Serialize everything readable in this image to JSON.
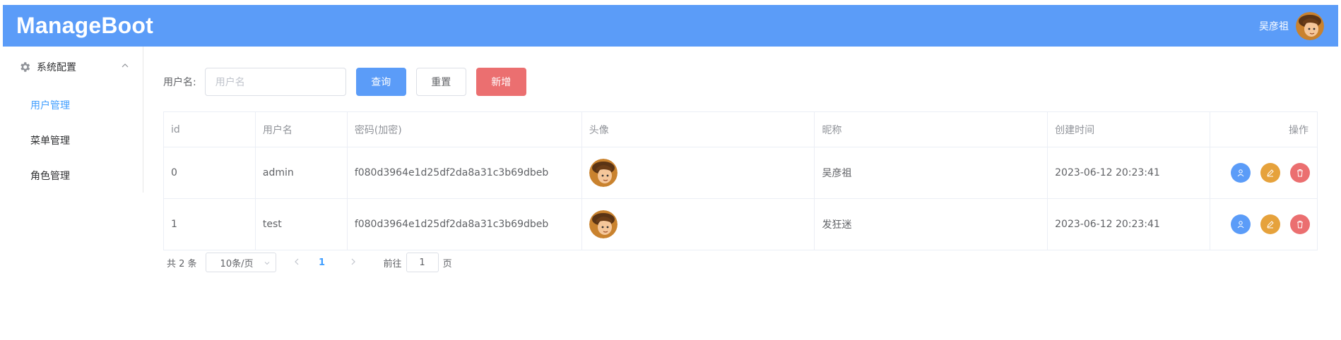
{
  "app": {
    "title": "ManageBoot"
  },
  "header": {
    "user_name": "吴彦祖"
  },
  "sidebar": {
    "group": {
      "label": "系统配置",
      "icon": "gear-icon",
      "expanded": true
    },
    "items": [
      {
        "label": "用户管理",
        "active": true
      },
      {
        "label": "菜单管理",
        "active": false
      },
      {
        "label": "角色管理",
        "active": false
      }
    ]
  },
  "search": {
    "label": "用户名:",
    "placeholder": "用户名",
    "value": "",
    "query_label": "查询",
    "reset_label": "重置",
    "add_label": "新增"
  },
  "table": {
    "columns": [
      "id",
      "用户名",
      "密码(加密)",
      "头像",
      "昵称",
      "创建时间",
      "操作"
    ],
    "rows": [
      {
        "id": "0",
        "username": "admin",
        "password": "f080d3964e1d25df2da8a31c3b69dbeb",
        "avatar": "avatar-image",
        "nickname": "吴彦祖",
        "created": "2023-06-12 20:23:41"
      },
      {
        "id": "1",
        "username": "test",
        "password": "f080d3964e1d25df2da8a31c3b69dbeb",
        "avatar": "avatar-image",
        "nickname": "发狂迷",
        "created": "2023-06-12 20:23:41"
      }
    ],
    "row_actions": [
      {
        "icon": "user-icon",
        "color": "#5b9cf8"
      },
      {
        "icon": "edit-icon",
        "color": "#e6a23c"
      },
      {
        "icon": "delete-icon",
        "color": "#eb6f70"
      }
    ]
  },
  "pagination": {
    "total_label": "共 2 条",
    "page_size": "10条/页",
    "current_page": "1",
    "goto_prefix": "前往",
    "goto_value": "1",
    "goto_suffix": "页"
  },
  "colors": {
    "header_bg": "#5b9cf8",
    "primary": "#5b9cf8",
    "danger": "#eb6f70",
    "warning": "#e6a23c",
    "active_menu": "#409eff"
  }
}
